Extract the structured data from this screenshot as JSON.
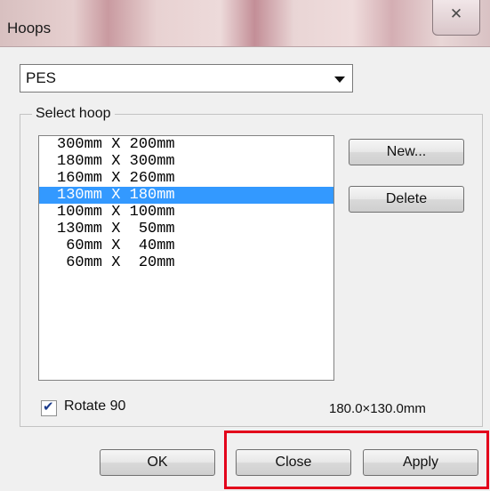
{
  "window": {
    "title": "Hoops",
    "close_glyph": "✕"
  },
  "format_select": {
    "value": "PES"
  },
  "hoop_group": {
    "label": "Select hoop",
    "items": [
      {
        "label": "300mm X 200mm",
        "selected": false
      },
      {
        "label": "180mm X 300mm",
        "selected": false
      },
      {
        "label": "160mm X 260mm",
        "selected": false
      },
      {
        "label": "130mm X 180mm",
        "selected": true
      },
      {
        "label": "100mm X 100mm",
        "selected": false
      },
      {
        "label": "130mm X  50mm",
        "selected": false
      },
      {
        "label": " 60mm X  40mm",
        "selected": false
      },
      {
        "label": " 60mm X  20mm",
        "selected": false
      }
    ],
    "new_label": "New...",
    "delete_label": "Delete",
    "rotate_label": "Rotate 90",
    "rotate_checked": true,
    "dimensions": "180.0×130.0mm"
  },
  "footer": {
    "ok_label": "OK",
    "close_label": "Close",
    "apply_label": "Apply"
  },
  "colors": {
    "selection": "#3399ff",
    "highlight_frame": "#e3001b"
  }
}
